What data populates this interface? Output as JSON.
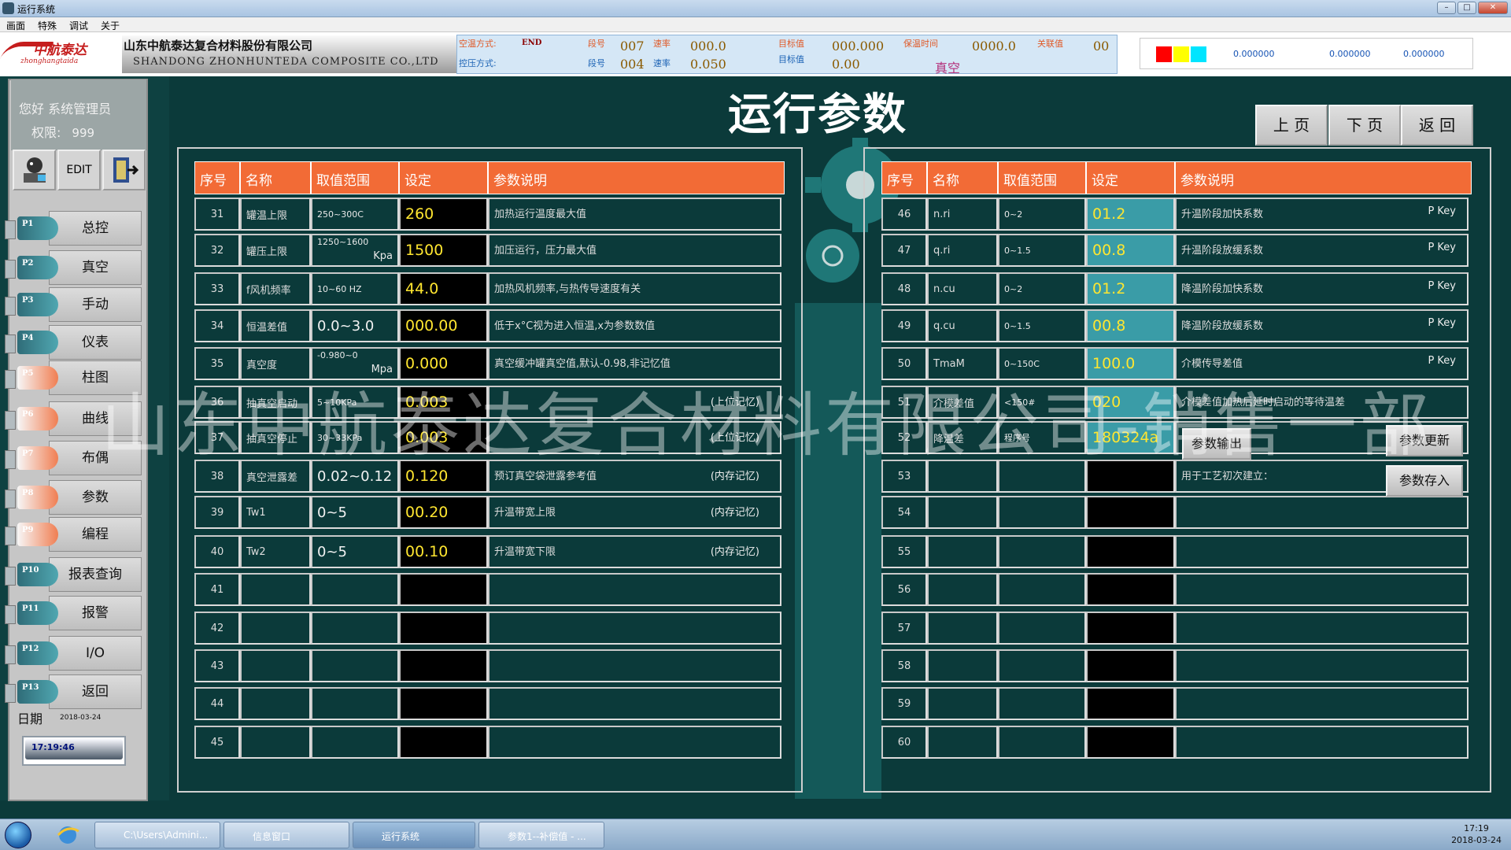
{
  "window": {
    "title": "运行系统"
  },
  "menu": [
    "画面",
    "特殊",
    "调试",
    "关于"
  ],
  "header": {
    "logo_text": "中航泰达",
    "logo_sub": "zhonghangtaida",
    "company_cn": "山东中航泰达复合材料股份有限公司",
    "company_en": "SHANDONG ZHONHUNTEDA COMPOSITE CO.,LTD",
    "status": {
      "temp_mode_label": "空温方式:",
      "temp_mode_value": "END",
      "pressure_mode_label": "控压方式:",
      "seg_label_1": "段号",
      "seg_value_1": "007",
      "seg_label_2": "段号",
      "seg_value_2": "004",
      "rate_label_1": "速率",
      "rate_value_1": "000.0",
      "rate_label_2": "速率",
      "rate_value_2": "0.050",
      "target_label_1": "目标值",
      "target_value_1": "000.000",
      "target_label_2": "目标值",
      "target_value_2": "0.00",
      "hold_label": "保温时间",
      "hold_value": "0000.0",
      "related_label": "关联值",
      "related_value": "00",
      "vacuum_text": "真空"
    },
    "right_values": [
      "0.000000",
      "0.000000",
      "0.000000"
    ],
    "right_colors": [
      "#ff0000",
      "#ffff00",
      "#00e5ff"
    ]
  },
  "sidebar": {
    "greeting": "您好  系统管理员",
    "perm_label": "权限:",
    "perm_value": "999",
    "edit_label": "EDIT",
    "items": [
      {
        "tag": "P1",
        "label": "总控"
      },
      {
        "tag": "P2",
        "label": "真空"
      },
      {
        "tag": "P3",
        "label": "手动"
      },
      {
        "tag": "P4",
        "label": "仪表"
      },
      {
        "tag": "P5",
        "label": "柱图"
      },
      {
        "tag": "P6",
        "label": "曲线"
      },
      {
        "tag": "P7",
        "label": "布偶"
      },
      {
        "tag": "P8",
        "label": "参数"
      },
      {
        "tag": "P9",
        "label": "编程"
      },
      {
        "tag": "P10",
        "label": "报表查询"
      },
      {
        "tag": "P11",
        "label": "报警"
      },
      {
        "tag": "P12",
        "label": "I/O"
      },
      {
        "tag": "P13",
        "label": "返回"
      }
    ],
    "date_label": "日期",
    "date_value": "2018-03-24",
    "time_value": "17:19:46"
  },
  "page": {
    "title": "运行参数",
    "prev": "上 页",
    "next": "下 页",
    "back": "返 回"
  },
  "table_headers": [
    "序号",
    "名称",
    "取值范围",
    "设定",
    "参数说明"
  ],
  "left_rows": [
    {
      "no": "31",
      "name": "罐温上限",
      "range": "250~300C",
      "set": "260",
      "desc": "加热运行温度最大值",
      "note": ""
    },
    {
      "no": "32",
      "name": "罐压上限",
      "range": "1250~1600",
      "range2": "Kpa",
      "set": "1500",
      "desc": "加压运行，压力最大值",
      "note": ""
    },
    {
      "no": "33",
      "name": "f风机频率",
      "range": "10~60 HZ",
      "set": "44.0",
      "desc": "加热风机频率,与热传导速度有关",
      "note": ""
    },
    {
      "no": "34",
      "name": "恒温差值",
      "range": "0.0~3.0",
      "set": "000.00",
      "desc": "低于x°C视为进入恒温,x为参数数值",
      "note": ""
    },
    {
      "no": "35",
      "name": "真空度",
      "range": "-0.980~0",
      "range2": "Mpa",
      "set": "0.000",
      "desc": "真空缓冲罐真空值,默认-0.98,非记忆值",
      "note": ""
    },
    {
      "no": "36",
      "name": "抽真空启动",
      "range": "5~10KPa",
      "set": "0.003",
      "desc": "",
      "note": "(上位记忆)"
    },
    {
      "no": "37",
      "name": "抽真空停止",
      "range": "30~33KPa",
      "set": "0.003",
      "desc": "",
      "note": "(上位记忆)"
    },
    {
      "no": "38",
      "name": "真空泄露差",
      "range": "0.02~0.12",
      "set": "0.120",
      "desc": "预订真空袋泄露参考值",
      "note": "(内存记忆)"
    },
    {
      "no": "39",
      "name": "Tw1",
      "range": "0~5",
      "set": "00.20",
      "desc": "升温带宽上限",
      "note": "(内存记忆)"
    },
    {
      "no": "40",
      "name": "Tw2",
      "range": "0~5",
      "set": "00.10",
      "desc": "升温带宽下限",
      "note": "(内存记忆)"
    },
    {
      "no": "41",
      "name": "",
      "range": "",
      "set": "",
      "desc": "",
      "note": ""
    },
    {
      "no": "42",
      "name": "",
      "range": "",
      "set": "",
      "desc": "",
      "note": ""
    },
    {
      "no": "43",
      "name": "",
      "range": "",
      "set": "",
      "desc": "",
      "note": ""
    },
    {
      "no": "44",
      "name": "",
      "range": "",
      "set": "",
      "desc": "",
      "note": ""
    },
    {
      "no": "45",
      "name": "",
      "range": "",
      "set": "",
      "desc": "",
      "note": ""
    }
  ],
  "right_rows": [
    {
      "no": "46",
      "name": "n.ri",
      "range": "0~2",
      "set": "01.2",
      "desc": "升温阶段加快系数",
      "note": "P Key"
    },
    {
      "no": "47",
      "name": "q.ri",
      "range": "0~1.5",
      "set": "00.8",
      "desc": "升温阶段放缓系数",
      "note": "P Key"
    },
    {
      "no": "48",
      "name": "n.cu",
      "range": "0~2",
      "set": "01.2",
      "desc": "降温阶段加快系数",
      "note": "P Key"
    },
    {
      "no": "49",
      "name": "q.cu",
      "range": "0~1.5",
      "set": "00.8",
      "desc": "降温阶段放缓系数",
      "note": "P Key"
    },
    {
      "no": "50",
      "name": "TmaM",
      "range": "0~150C",
      "set": "100.0",
      "desc": "介模传导差值",
      "note": "P Key"
    },
    {
      "no": "51",
      "name": "介模差值",
      "range": "<150#",
      "set": "020",
      "desc": "介模差值加热后延时启动的等待温差",
      "note": ""
    },
    {
      "no": "52",
      "name": "降温差",
      "range": "程序号",
      "set": "180324a",
      "desc": "",
      "note": ""
    },
    {
      "no": "53",
      "name": "",
      "range": "",
      "set": "",
      "desc": "用于工艺初次建立：",
      "note": ""
    },
    {
      "no": "54",
      "name": "",
      "range": "",
      "set": "",
      "desc": "",
      "note": ""
    },
    {
      "no": "55",
      "name": "",
      "range": "",
      "set": "",
      "desc": "",
      "note": ""
    },
    {
      "no": "56",
      "name": "",
      "range": "",
      "set": "",
      "desc": "",
      "note": ""
    },
    {
      "no": "57",
      "name": "",
      "range": "",
      "set": "",
      "desc": "",
      "note": ""
    },
    {
      "no": "58",
      "name": "",
      "range": "",
      "set": "",
      "desc": "",
      "note": ""
    },
    {
      "no": "59",
      "name": "",
      "range": "",
      "set": "",
      "desc": "",
      "note": ""
    },
    {
      "no": "60",
      "name": "",
      "range": "",
      "set": "",
      "desc": "",
      "note": ""
    }
  ],
  "buttons": {
    "export": "参数输出",
    "refresh": "参数更新",
    "save": "参数存入"
  },
  "watermark": "山东中航泰达复合材料有限公司-销售一部",
  "taskbar": {
    "tasks": [
      "C:\\Users\\Admini...",
      "信息窗口",
      "运行系统",
      "参数1--补偿值 - ..."
    ],
    "time": "17:19",
    "date": "2018-03-24"
  }
}
